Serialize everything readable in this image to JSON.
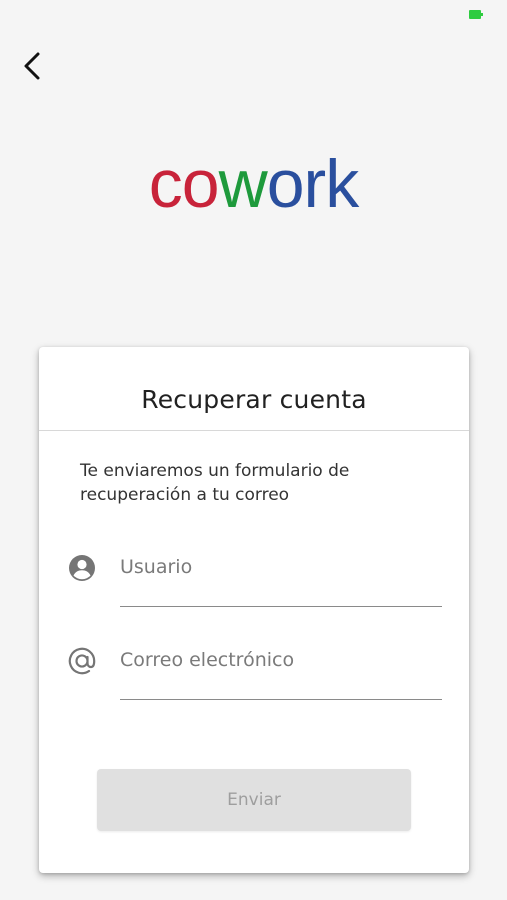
{
  "logo": {
    "letters": [
      {
        "char": "c",
        "color": "#c8233a"
      },
      {
        "char": "o",
        "color": "#c8233a"
      },
      {
        "char": "w",
        "color": "#1e9a3c"
      },
      {
        "char": "o",
        "color": "#2a4f9e"
      },
      {
        "char": "r",
        "color": "#2a4f9e"
      },
      {
        "char": "k",
        "color": "#2a4f9e"
      }
    ]
  },
  "card": {
    "title": "Recuperar cuenta",
    "description": "Te enviaremos un formulario de recuperación a tu correo"
  },
  "fields": {
    "username": {
      "placeholder": "Usuario",
      "value": "",
      "icon": "account-circle-icon"
    },
    "email": {
      "placeholder": "Correo electrónico",
      "value": "",
      "icon": "at-sign-icon"
    }
  },
  "submit": {
    "label": "Enviar",
    "enabled": false
  },
  "colors": {
    "background": "#f5f5f5",
    "card": "#ffffff",
    "button_disabled": "#e0e0e0",
    "status_battery": "#2ecc40"
  }
}
